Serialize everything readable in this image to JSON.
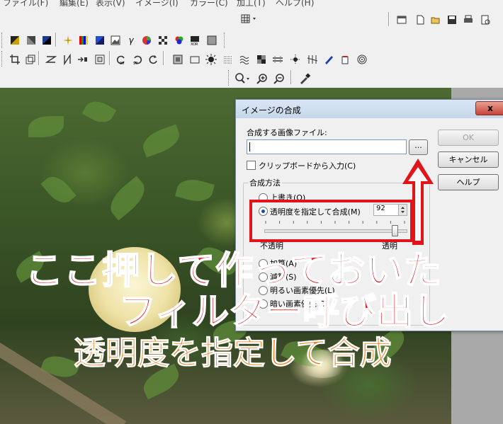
{
  "menu": [
    "ファイル(F)",
    "編集(E)",
    "表示(V)",
    "イメージ(I)",
    "カラー(C)",
    "加工(T)",
    "ヘルプ(H)"
  ],
  "dialog": {
    "title": "イメージの合成",
    "close_label": "x",
    "file_label": "合成する画像ファイル:",
    "file_value": "",
    "browse_label": "...",
    "clipboard_label": "クリップボードから入力(C)",
    "method_label": "合成方法",
    "overwrite_label": "上書き(O)",
    "transparency_label": "透明度を指定して合成(M)",
    "transparency_value": "92",
    "slider_fraction": 0.92,
    "opaque_label": "不透明",
    "transparent_label": "透明",
    "add_label": "加算(A)",
    "subtract_label": "減算(S)",
    "bright_label": "明るい画素優先(L)",
    "dark_label": "暗い画素優先(D)",
    "ok_label": "OK",
    "cancel_label": "キャンセル",
    "help_label": "ヘルプ"
  },
  "annotations": {
    "line1": "ここ押して作っておいた",
    "line2": "フィルター呼び出し",
    "line3": "透明度を指定して合成"
  },
  "colors": {
    "annotation_red": "#e1141a",
    "annotation_orange": "#f07a10",
    "title_gradient": "#c5d6ec"
  }
}
